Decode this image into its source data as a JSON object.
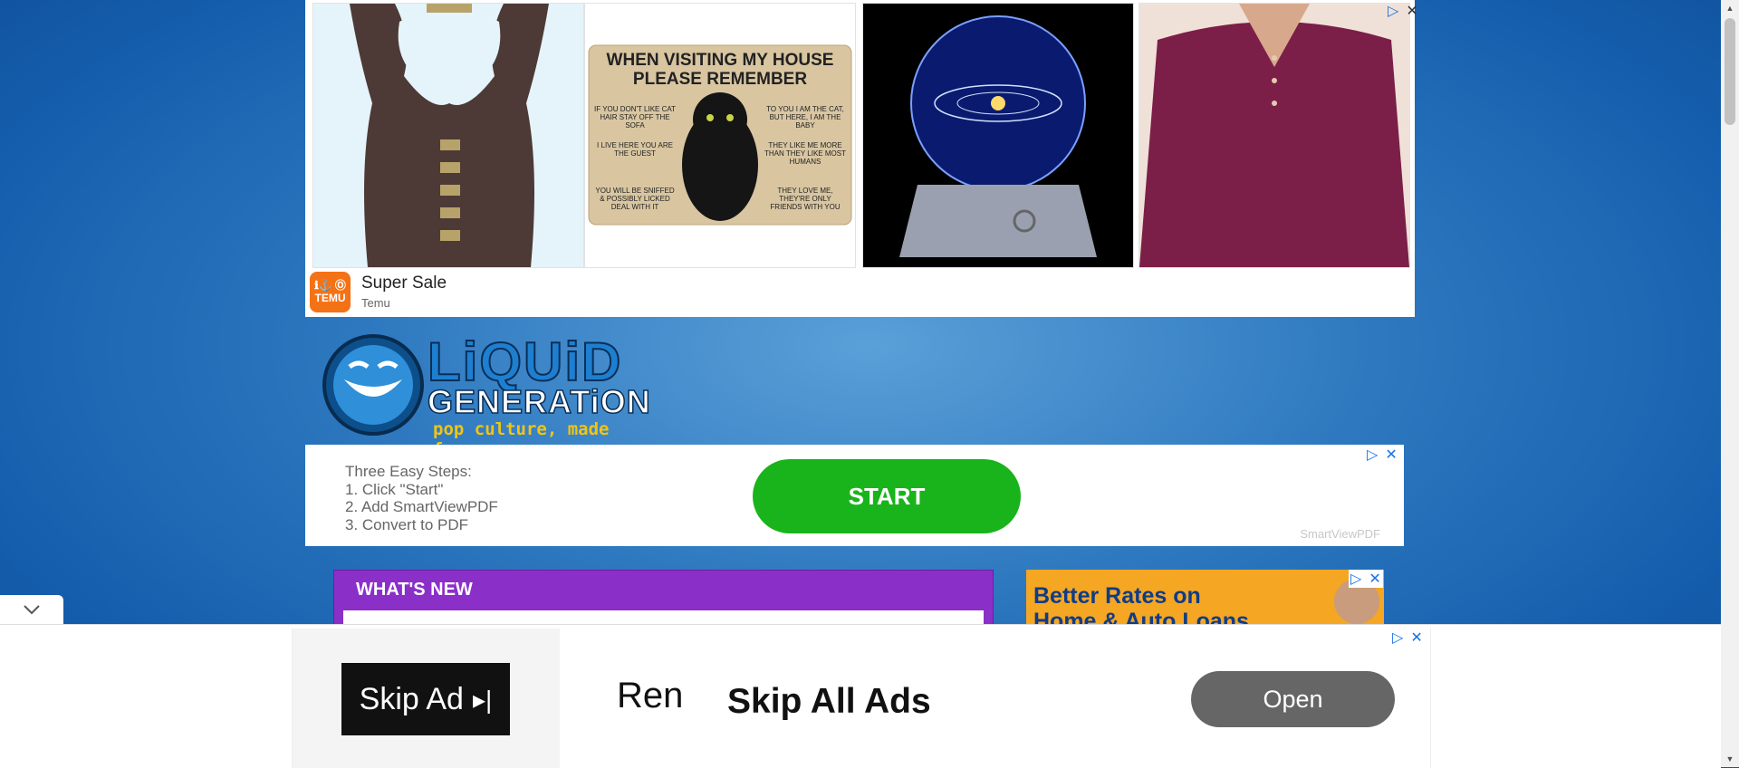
{
  "top_ad": {
    "brand_title": "Super Sale",
    "brand_sub": "Temu",
    "logo_text_line1": "ℹ⚓ Ⓞ",
    "logo_text_line2": "TEMU",
    "sign_title": "WHEN VISITING MY HOUSE PLEASE REMEMBER",
    "sign_left_1": "IF YOU DON'T LIKE CAT HAIR STAY OFF THE SOFA",
    "sign_left_2": "I LIVE HERE YOU ARE THE GUEST",
    "sign_left_3": "YOU WILL BE SNIFFED & POSSIBLY LICKED DEAL WITH IT",
    "sign_right_1": "TO YOU I AM THE CAT, BUT HERE, I AM THE BABY",
    "sign_right_2": "THEY LIKE ME MORE THAN THEY LIKE MOST HUMANS",
    "sign_right_3": "THEY LOVE ME, THEY'RE ONLY FRIENDS WITH YOU"
  },
  "logo": {
    "line1": "LiQUiD",
    "line2": "GENERATiON",
    "tagline": "pop culture, made funny."
  },
  "pdf_ad": {
    "steps": [
      "Three Easy Steps:",
      "1. Click \"Start\"",
      "2. Add SmartViewPDF",
      "3. Convert to PDF"
    ],
    "start_label": "START",
    "brand": "SmartViewPDF"
  },
  "whats_new": {
    "title": "WHAT'S NEW"
  },
  "loan_ad": {
    "line1": "Better Rates on",
    "line2": "Home & Auto Loans"
  },
  "anchor_ad": {
    "skip_ad": "Skip Ad",
    "rem": "Ren",
    "skip_all": "Skip All Ads",
    "open": "Open"
  },
  "colors": {
    "accent_purple": "#8b2fc9",
    "start_green": "#19b41b",
    "temu_orange": "#f47216"
  }
}
